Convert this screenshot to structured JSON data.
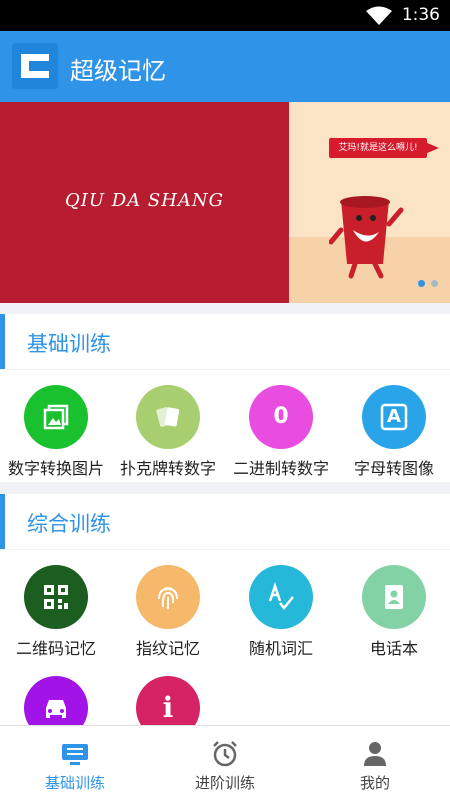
{
  "status_bar": {
    "time": "1:36",
    "wifi_icon": "wifi-icon"
  },
  "app_bar": {
    "logo_icon": "app-logo-c",
    "title": "超级记忆"
  },
  "banner": {
    "slide_text": "QIU DA SHANG",
    "bubble_text": "艾玛!就是这么嘚儿!",
    "page_count": 2,
    "active_page": 1,
    "left_color": "#b81c30",
    "right_color": "#fbe3c6"
  },
  "sections": [
    {
      "title": "基础训练",
      "items": [
        {
          "label": "数字转换图片",
          "icon": "image-icon",
          "color": "#19c12f"
        },
        {
          "label": "扑克牌转数字",
          "icon": "cards-icon",
          "color": "#a8cf6f"
        },
        {
          "label": "二进制转数字",
          "icon": "zero-icon",
          "glyph": "0",
          "color": "#e84de0"
        },
        {
          "label": "字母转图像",
          "icon": "letter-a-icon",
          "glyph": "A",
          "color": "#2aa4e8"
        }
      ]
    },
    {
      "title": "综合训练",
      "items": [
        {
          "label": "二维码记忆",
          "icon": "qr-code-icon",
          "color": "#1b5e20"
        },
        {
          "label": "指纹记忆",
          "icon": "fingerprint-icon",
          "color": "#f6b86a"
        },
        {
          "label": "随机词汇",
          "icon": "spellcheck-icon",
          "color": "#25b8d8"
        },
        {
          "label": "电话本",
          "icon": "contact-book-icon",
          "color": "#82d2a6"
        },
        {
          "label": "",
          "icon": "car-icon",
          "color": "#a213e8"
        },
        {
          "label": "",
          "icon": "info-icon",
          "glyph": "i",
          "color": "#d62363"
        }
      ]
    }
  ],
  "bottom_nav": [
    {
      "label": "基础训练",
      "icon": "monitor-icon",
      "active": true
    },
    {
      "label": "进阶训练",
      "icon": "alarm-clock-icon",
      "active": false
    },
    {
      "label": "我的",
      "icon": "person-icon",
      "active": false
    }
  ],
  "colors": {
    "primary": "#2f93e8",
    "background": "#f0f2f5"
  }
}
